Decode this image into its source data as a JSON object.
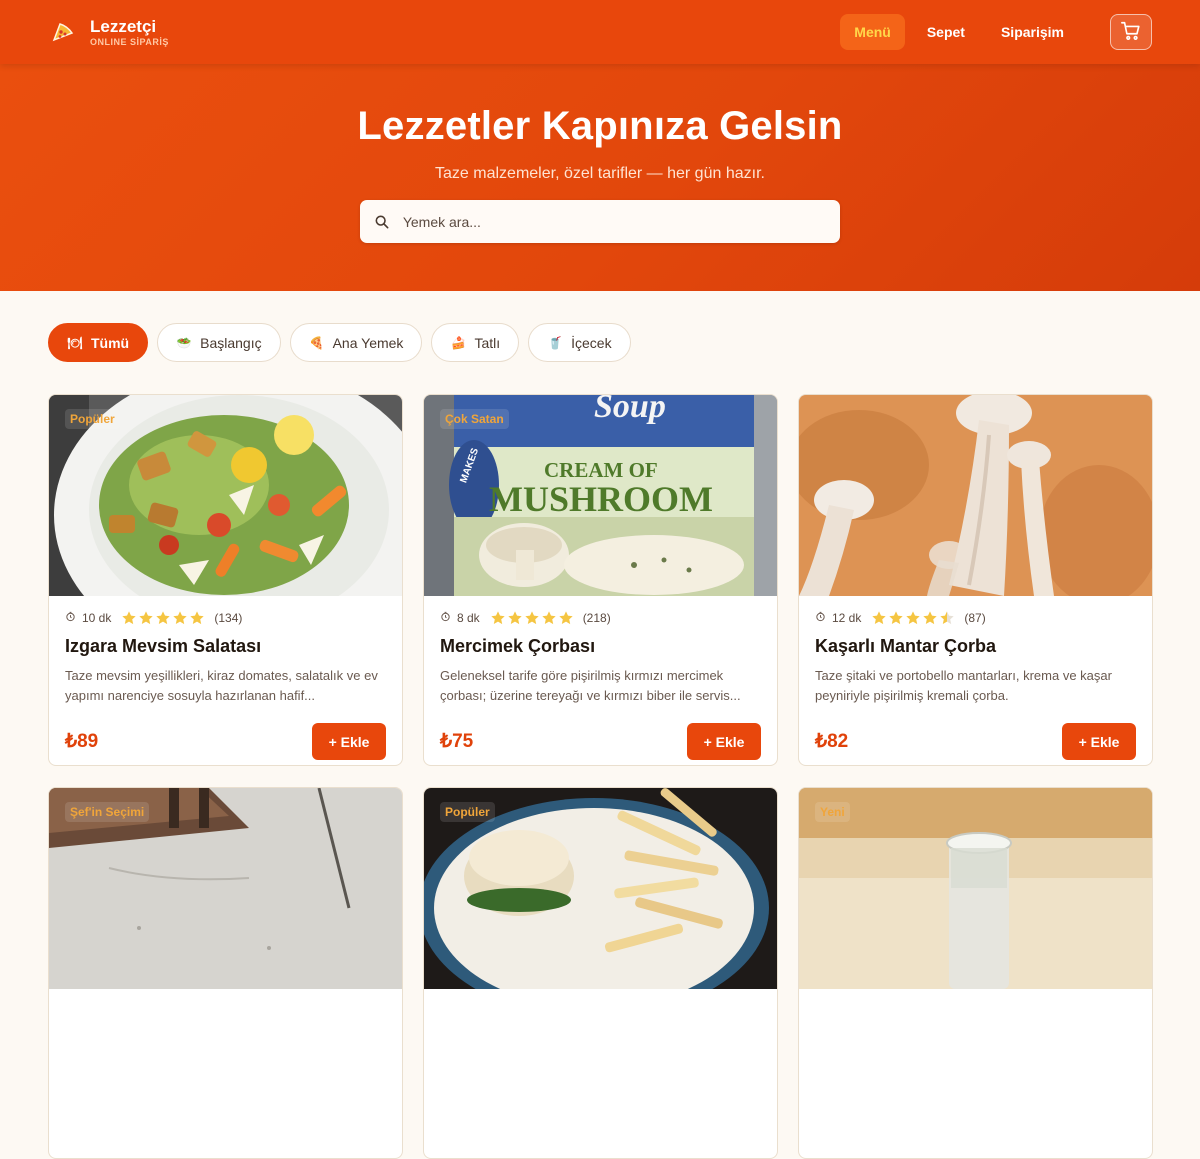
{
  "brand": {
    "name": "Lezzetçi",
    "subtitle": "ONLINE SİPARİŞ",
    "icon": "pizza-slice-icon"
  },
  "nav": {
    "links": [
      {
        "label": "Menü",
        "active": true
      },
      {
        "label": "Sepet",
        "active": false
      },
      {
        "label": "Siparişim",
        "active": false
      }
    ],
    "cart_icon": "cart-icon"
  },
  "hero": {
    "title": "Lezzetler Kapınıza Gelsin",
    "subtitle": "Taze malzemeler, özel tarifler — her gün hazır.",
    "search_placeholder": "Yemek ara..."
  },
  "categories": [
    {
      "label": "Tümü",
      "icon": "🍽",
      "active": true
    },
    {
      "label": "Başlangıç",
      "icon": "🥗",
      "active": false
    },
    {
      "label": "Ana Yemek",
      "icon": "🍕",
      "active": false
    },
    {
      "label": "Tatlı",
      "icon": "🍰",
      "active": false
    },
    {
      "label": "İçecek",
      "icon": "🥤",
      "active": false
    }
  ],
  "products": [
    {
      "badge": "Popüler",
      "time": "10 dk",
      "rating": 5,
      "reviews": "(134)",
      "title": "Izgara Mevsim Salatası",
      "desc": "Taze mevsim yeşillikleri, kiraz domates, salatalık ve ev yapımı narenciye sosuyla hazırlanan hafif...",
      "price": "₺89",
      "button": "+ Ekle",
      "image": "salad-photo"
    },
    {
      "badge": "Çok Satan",
      "time": "8 dk",
      "rating": 5,
      "reviews": "(218)",
      "title": "Mercimek Çorbası",
      "desc": "Geleneksel tarife göre pişirilmiş kırmızı mercimek çorbası; üzerine tereyağı ve kırmızı biber ile servis...",
      "price": "₺75",
      "button": "+ Ekle",
      "image": "cream-of-mushroom-can-photo",
      "image_text": "CREAM OF MUSHROOM"
    },
    {
      "badge": "",
      "time": "12 dk",
      "rating": 4.5,
      "reviews": "(87)",
      "title": "Kaşarlı Mantar Çorba",
      "desc": "Taze şitaki ve portobello mantarları, krema ve kaşar peyniriyle pişirilmiş kremali çorba.",
      "price": "₺82",
      "button": "+ Ekle",
      "image": "mushrooms-photo"
    },
    {
      "badge": "Şef'in Seçimi",
      "image": "wall-photo"
    },
    {
      "badge": "Popüler",
      "image": "burger-fries-photo"
    },
    {
      "badge": "Yeni",
      "image": "glass-photo"
    }
  ],
  "colors": {
    "primary": "#e8470c",
    "star": "#f5c542",
    "background": "#fdf9f3"
  }
}
